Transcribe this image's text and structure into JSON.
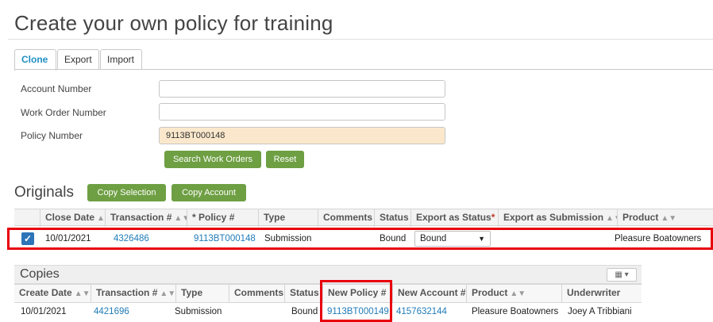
{
  "page": {
    "title": "Create your own policy for training"
  },
  "tabs": [
    {
      "label": "Clone",
      "active": true
    },
    {
      "label": "Export",
      "active": false
    },
    {
      "label": "Import",
      "active": false
    }
  ],
  "form": {
    "account_number": {
      "label": "Account Number",
      "value": ""
    },
    "work_order_number": {
      "label": "Work Order Number",
      "value": ""
    },
    "policy_number": {
      "label": "Policy Number",
      "value": "9113BT000148"
    },
    "search_button": "Search Work Orders",
    "reset_button": "Reset"
  },
  "originals": {
    "title": "Originals",
    "copy_selection_button": "Copy Selection",
    "copy_account_button": "Copy Account",
    "columns": [
      "Close Date",
      "Transaction #",
      "* Policy #",
      "Type",
      "Comments",
      "Status",
      "Export as Status",
      "*",
      "Export as Submission",
      "Product"
    ],
    "row": {
      "checked": true,
      "close_date": "10/01/2021",
      "transaction": "4326486",
      "policy": "9113BT000148",
      "type": "Submission",
      "comments": "",
      "status": "Bound",
      "export_status": "Bound",
      "export_submission": "",
      "product": "Pleasure Boatowners"
    }
  },
  "copies": {
    "title": "Copies",
    "columns": [
      "Create Date",
      "Transaction #",
      "Type",
      "Comments",
      "Status",
      "New Policy #",
      "New Account #",
      "Product",
      "Underwriter"
    ],
    "row": {
      "create_date": "10/01/2021",
      "transaction": "4421696",
      "type": "Submission",
      "comments": "",
      "status": "Bound",
      "new_policy": "9113BT000149",
      "new_account": "4157632144",
      "product": "Pleasure Boatowners",
      "underwriter": "Joey A Tribbiani"
    }
  },
  "icons": {
    "sort": "sort-icon",
    "check": "check-icon",
    "dropdown": "chevron-down-icon",
    "grid_menu": "grid-menu-icon"
  },
  "colors": {
    "accent_green": "#6e9f43",
    "link_blue": "#1f7bb8",
    "highlight_red": "#e8000b",
    "filled_input": "#fbe8cc"
  }
}
